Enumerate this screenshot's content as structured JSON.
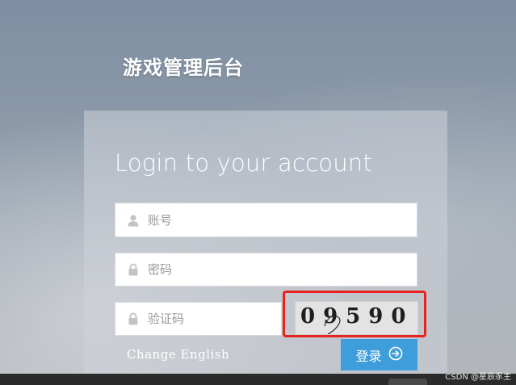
{
  "page": {
    "heading": "游戏管理后台"
  },
  "login": {
    "title": "Login to your account",
    "username": {
      "placeholder": "账号",
      "icon": "user-icon"
    },
    "password": {
      "placeholder": "密码",
      "icon": "lock-icon"
    },
    "captcha": {
      "placeholder": "验证码",
      "icon": "lock-icon",
      "code": "09590"
    },
    "change_language": "Change English",
    "submit_label": "登录",
    "submit_icon": "arrow-circle-right-icon"
  },
  "colors": {
    "accent": "#3e9ddb",
    "highlight_frame": "#e8221c"
  },
  "watermark": "CSDN @星辰豕主"
}
